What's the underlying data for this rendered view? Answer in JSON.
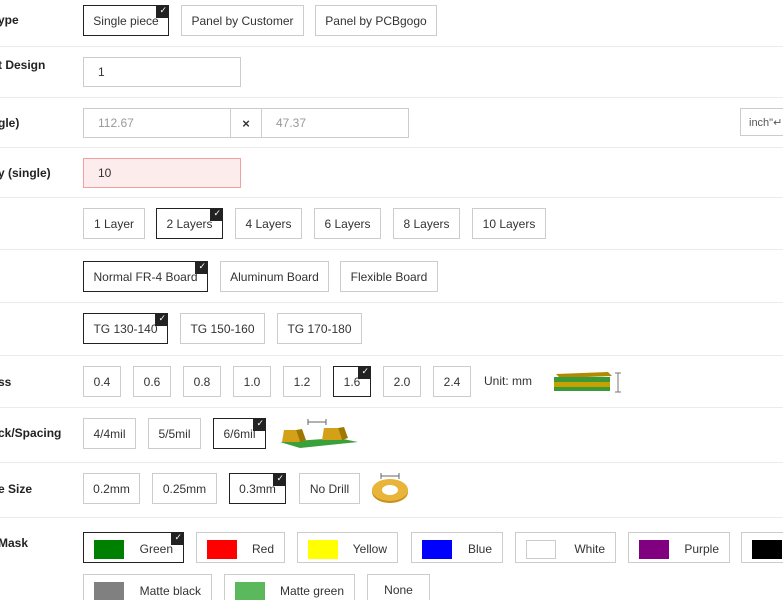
{
  "rows": {
    "board_type": {
      "label": "ype",
      "options": [
        "Single piece",
        "Panel by Customer",
        "Panel by PCBgogo"
      ],
      "selected": 0
    },
    "different_design": {
      "label": "t Design",
      "value": "1"
    },
    "size": {
      "label": "gle)",
      "width": "112.67",
      "height": "47.37",
      "times": "×",
      "unit": "inch\"↵"
    },
    "quantity": {
      "label": "y (single)",
      "value": "10"
    },
    "layers": {
      "options": [
        "1 Layer",
        "2 Layers",
        "4 Layers",
        "6 Layers",
        "8 Layers",
        "10 Layers"
      ],
      "selected": 1
    },
    "material": {
      "options": [
        "Normal FR-4 Board",
        "Aluminum Board",
        "Flexible Board"
      ],
      "selected": 0
    },
    "tg": {
      "options": [
        "TG 130-140",
        "TG 150-160",
        "TG 170-180"
      ],
      "selected": 0
    },
    "thickness": {
      "label": "ss",
      "options": [
        "0.4",
        "0.6",
        "0.8",
        "1.0",
        "1.2",
        "1.6",
        "2.0",
        "2.4"
      ],
      "selected": 5,
      "unit": "Unit: mm"
    },
    "trace": {
      "label": "ck/Spacing",
      "options": [
        "4/4mil",
        "5/5mil",
        "6/6mil"
      ],
      "selected": 2
    },
    "hole": {
      "label": "e Size",
      "options": [
        "0.2mm",
        "0.25mm",
        "0.3mm",
        "No Drill"
      ],
      "selected": 2
    },
    "mask": {
      "label": "Mask",
      "options": [
        {
          "name": "Green",
          "color": "#008000"
        },
        {
          "name": "Red",
          "color": "#ff0000"
        },
        {
          "name": "Yellow",
          "color": "#ffff00"
        },
        {
          "name": "Blue",
          "color": "#0000ff"
        },
        {
          "name": "White",
          "color": "#ffffff"
        },
        {
          "name": "Purple",
          "color": "#800080"
        },
        {
          "name": "",
          "color": "#000000"
        },
        {
          "name": "Matte black",
          "color": "#808080"
        },
        {
          "name": "Matte green",
          "color": "#5cb85c"
        },
        {
          "name": "None",
          "color": ""
        }
      ],
      "selected": 0
    }
  },
  "check_glyph": "✓"
}
